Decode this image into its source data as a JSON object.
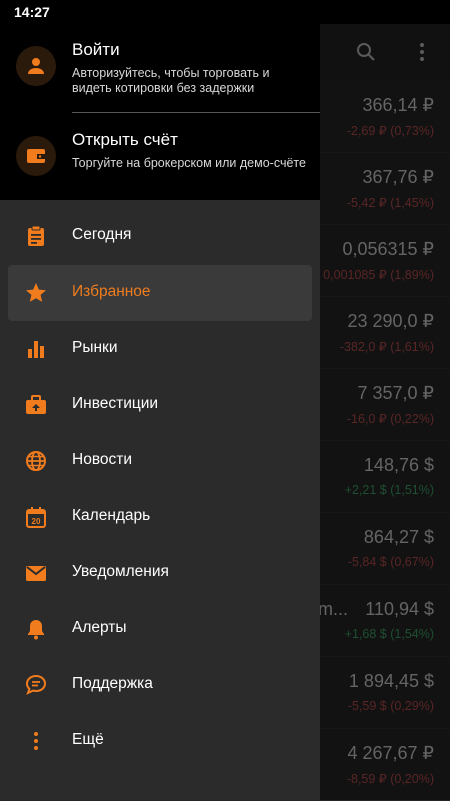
{
  "status_bar": {
    "time": "14:27"
  },
  "colors": {
    "accent": "#f07c1e",
    "negative": "#d04a4a",
    "positive": "#3aa56a"
  },
  "drawer": {
    "login": {
      "title": "Войти",
      "subtitle": "Авторизуйтесь, чтобы торговать и видеть котировки без задержки",
      "icon": "person-icon"
    },
    "open_account": {
      "title": "Открыть счёт",
      "subtitle": "Торгуйте на брокерском или демо-счёте",
      "icon": "wallet-icon"
    },
    "menu_items": [
      {
        "label": "Сегодня",
        "icon": "clipboard-icon",
        "active": false
      },
      {
        "label": "Избранное",
        "icon": "star-icon",
        "active": true
      },
      {
        "label": "Рынки",
        "icon": "bar-chart-icon",
        "active": false
      },
      {
        "label": "Инвестиции",
        "icon": "briefcase-icon",
        "active": false
      },
      {
        "label": "Новости",
        "icon": "globe-icon",
        "active": false
      },
      {
        "label": "Календарь",
        "icon": "calendar-icon",
        "calendar_day": "20",
        "active": false
      },
      {
        "label": "Уведомления",
        "icon": "mail-icon",
        "active": false
      },
      {
        "label": "Алерты",
        "icon": "bell-icon",
        "active": false
      },
      {
        "label": "Поддержка",
        "icon": "chat-icon",
        "active": false
      },
      {
        "label": "Ещё",
        "icon": "more-vertical-icon",
        "active": false
      }
    ]
  },
  "background_list": {
    "toolbar_icons": [
      "search-icon",
      "more-vertical-icon"
    ],
    "rows": [
      {
        "price": "366,14 ₽",
        "change": "-2,69 ₽ (0,73%)",
        "direction": "negative"
      },
      {
        "price": "367,76 ₽",
        "change": "-5,42 ₽ (1,45%)",
        "direction": "negative"
      },
      {
        "price": "0,056315 ₽",
        "change": "0,001085 ₽ (1,89%)",
        "direction": "negative"
      },
      {
        "price": "23 290,0 ₽",
        "change": "-382,0 ₽ (1,61%)",
        "direction": "negative"
      },
      {
        "price": "7 357,0 ₽",
        "change": "-16,0 ₽ (0,22%)",
        "direction": "negative"
      },
      {
        "price": "148,76 $",
        "change": "+2,21 $ (1,51%)",
        "direction": "positive"
      },
      {
        "price": "864,27 $",
        "change": "-5,84 $ (0,67%)",
        "direction": "negative"
      },
      {
        "name": "m...",
        "price": "110,94 $",
        "change": "+1,68 $ (1,54%)",
        "direction": "positive"
      },
      {
        "price": "1 894,45 $",
        "change": "-5,59 $ (0,29%)",
        "direction": "negative"
      },
      {
        "price": "4 267,67 ₽",
        "change": "-8,59 ₽ (0,20%)",
        "direction": "negative"
      }
    ]
  }
}
